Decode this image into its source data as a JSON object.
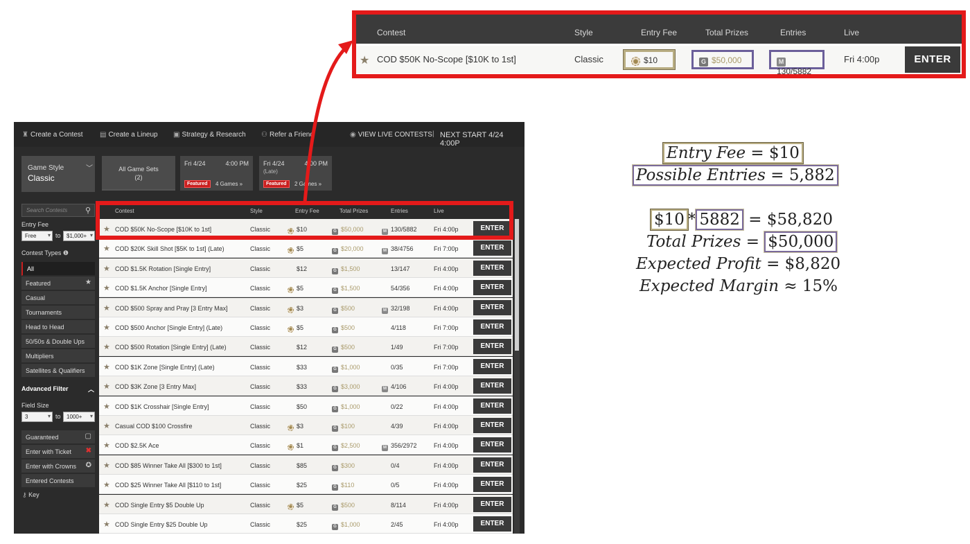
{
  "zoom": {
    "headers": {
      "contest": "Contest",
      "style": "Style",
      "fee": "Entry Fee",
      "prizes": "Total Prizes",
      "entries": "Entries",
      "live": "Live"
    },
    "row": {
      "name": "COD $50K No-Scope [$10K to 1st]",
      "style": "Classic",
      "fee": "$10",
      "prizes": "$50,000",
      "entries": "130/5882",
      "live": "Fri 4:00p",
      "enter": "ENTER"
    }
  },
  "nav": {
    "items": [
      "Create a Contest",
      "Create a Lineup",
      "Strategy & Research",
      "Refer a Friend"
    ],
    "live": "VIEW LIVE CONTESTS",
    "next": "NEXT START 4/24 4:00P"
  },
  "game_style": {
    "label": "Game Style",
    "value": "Classic"
  },
  "game_sets": {
    "all": "All Game Sets",
    "all_count": "(2)",
    "set1": {
      "date": "Fri 4/24",
      "time": "4:00 PM",
      "badge": "Featured",
      "games": "4 Games »"
    },
    "set2": {
      "date": "Fri 4/24",
      "late": "(Late)",
      "time": "4:00 PM",
      "badge": "Featured",
      "games": "2 Games »"
    }
  },
  "sidebar": {
    "search_placeholder": "Search Contests",
    "entry_fee_label": "Entry Fee",
    "fee_from": "Free",
    "fee_to": "$1,000+",
    "to": "to",
    "contest_types_label": "Contest Types",
    "types": [
      "All",
      "Featured",
      "Casual",
      "Tournaments",
      "Head to Head",
      "50/50s & Double Ups",
      "Multipliers",
      "Satellites & Qualifiers"
    ],
    "advanced": "Advanced Filter",
    "field_size_label": "Field Size",
    "size_from": "3",
    "size_to": "1000+",
    "filters": [
      "Guaranteed",
      "Enter with Ticket",
      "Enter with Crowns",
      "Entered Contests"
    ],
    "key": "Key"
  },
  "table": {
    "headers": {
      "contest": "Contest",
      "style": "Style",
      "fee": "Entry Fee",
      "prizes": "Total Prizes",
      "entries": "Entries",
      "live": "Live"
    },
    "enter": "ENTER",
    "rows": [
      {
        "name": "COD $50K No-Scope [$10K to 1st]",
        "style": "Classic",
        "fee": "$10",
        "prizes": "$50,000",
        "entries": "130/5882",
        "live": "Fri 4:00p",
        "ticket": true,
        "multi": true
      },
      {
        "name": "COD $20K Skill Shot [$5K to 1st] (Late)",
        "style": "Classic",
        "fee": "$5",
        "prizes": "$20,000",
        "entries": "38/4756",
        "live": "Fri 7:00p",
        "ticket": true,
        "multi": true
      },
      {
        "name": "COD $1.5K Rotation [Single Entry]",
        "style": "Classic",
        "fee": "$12",
        "prizes": "$1,500",
        "entries": "13/147",
        "live": "Fri 4:00p",
        "ticket": false,
        "multi": false
      },
      {
        "name": "COD $1.5K Anchor [Single Entry]",
        "style": "Classic",
        "fee": "$5",
        "prizes": "$1,500",
        "entries": "54/356",
        "live": "Fri 4:00p",
        "ticket": true,
        "multi": false
      },
      {
        "name": "COD $500 Spray and Pray [3 Entry Max]",
        "style": "Classic",
        "fee": "$3",
        "prizes": "$500",
        "entries": "32/198",
        "live": "Fri 4:00p",
        "ticket": true,
        "multi": true
      },
      {
        "name": "COD $500 Anchor [Single Entry] (Late)",
        "style": "Classic",
        "fee": "$5",
        "prizes": "$500",
        "entries": "4/118",
        "live": "Fri 7:00p",
        "ticket": true,
        "multi": false
      },
      {
        "name": "COD $500 Rotation [Single Entry] (Late)",
        "style": "Classic",
        "fee": "$12",
        "prizes": "$500",
        "entries": "1/49",
        "live": "Fri 7:00p",
        "ticket": false,
        "multi": false
      },
      {
        "name": "COD $1K Zone [Single Entry] (Late)",
        "style": "Classic",
        "fee": "$33",
        "prizes": "$1,000",
        "entries": "0/35",
        "live": "Fri 7:00p",
        "ticket": false,
        "multi": false
      },
      {
        "name": "COD $3K Zone [3 Entry Max]",
        "style": "Classic",
        "fee": "$33",
        "prizes": "$3,000",
        "entries": "4/106",
        "live": "Fri 4:00p",
        "ticket": false,
        "multi": true
      },
      {
        "name": "COD $1K Crosshair [Single Entry]",
        "style": "Classic",
        "fee": "$50",
        "prizes": "$1,000",
        "entries": "0/22",
        "live": "Fri 4:00p",
        "ticket": false,
        "multi": false
      },
      {
        "name": "Casual COD $100 Crossfire",
        "style": "Classic",
        "fee": "$3",
        "prizes": "$100",
        "entries": "4/39",
        "live": "Fri 4:00p",
        "ticket": true,
        "multi": false
      },
      {
        "name": "COD $2.5K Ace",
        "style": "Classic",
        "fee": "$1",
        "prizes": "$2,500",
        "entries": "356/2972",
        "live": "Fri 4:00p",
        "ticket": true,
        "multi": true
      },
      {
        "name": "COD $85 Winner Take All [$300 to 1st]",
        "style": "Classic",
        "fee": "$85",
        "prizes": "$300",
        "entries": "0/4",
        "live": "Fri 4:00p",
        "ticket": false,
        "multi": false
      },
      {
        "name": "COD $25 Winner Take All [$110 to 1st]",
        "style": "Classic",
        "fee": "$25",
        "prizes": "$110",
        "entries": "0/5",
        "live": "Fri 4:00p",
        "ticket": false,
        "multi": false
      },
      {
        "name": "COD Single Entry $5 Double Up",
        "style": "Classic",
        "fee": "$5",
        "prizes": "$500",
        "entries": "8/114",
        "live": "Fri 4:00p",
        "ticket": true,
        "multi": false
      },
      {
        "name": "COD Single Entry $25 Double Up",
        "style": "Classic",
        "fee": "$25",
        "prizes": "$1,000",
        "entries": "2/45",
        "live": "Fri 4:00p",
        "ticket": false,
        "multi": false
      }
    ]
  },
  "math": {
    "l1a": "Entry Fee",
    "l1b": " = $10",
    "l2a": "Possible Entries",
    "l2b": " = 5,882",
    "l3a": "$10",
    "l3op": "*",
    "l3b": "5882",
    "l3c": " = $58,820",
    "l4a": "Total Prizes",
    "l4b": " = ",
    "l4c": "$50,000",
    "l5a": "Expected Profit",
    "l5b": " = $8,820",
    "l6a": "Expected Margin",
    "l6b": " ≈ 15%"
  },
  "colors": {
    "highlight_red": "#e41a1a",
    "enter_btn": "#3a3a3a",
    "prize_gold": "#a99a6a"
  }
}
